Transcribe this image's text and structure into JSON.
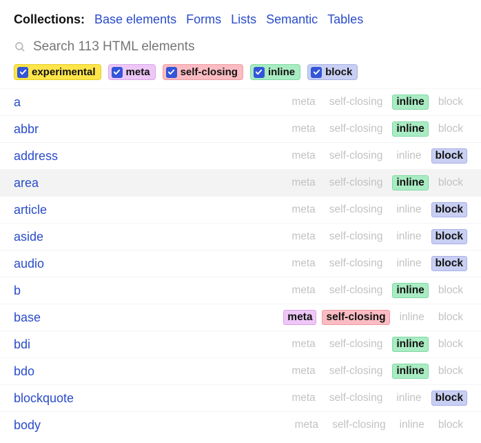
{
  "header": {
    "title": "Collections:",
    "links": [
      "Base elements",
      "Forms",
      "Lists",
      "Semantic",
      "Tables"
    ]
  },
  "search": {
    "placeholder": "Search 113 HTML elements"
  },
  "filters": [
    {
      "key": "experimental",
      "label": "experimental",
      "checked": true,
      "cls": "pill-experimental"
    },
    {
      "key": "meta",
      "label": "meta",
      "checked": true,
      "cls": "pill-meta"
    },
    {
      "key": "selfclosing",
      "label": "self-closing",
      "checked": true,
      "cls": "pill-selfclosing"
    },
    {
      "key": "inline",
      "label": "inline",
      "checked": true,
      "cls": "pill-inline"
    },
    {
      "key": "block",
      "label": "block",
      "checked": true,
      "cls": "pill-block"
    }
  ],
  "tagLabels": {
    "meta": "meta",
    "selfclosing": "self-closing",
    "inline": "inline",
    "block": "block"
  },
  "elements": [
    {
      "name": "a",
      "active": [
        "inline"
      ],
      "hover": false
    },
    {
      "name": "abbr",
      "active": [
        "inline"
      ],
      "hover": false
    },
    {
      "name": "address",
      "active": [
        "block"
      ],
      "hover": false
    },
    {
      "name": "area",
      "active": [
        "inline"
      ],
      "hover": true
    },
    {
      "name": "article",
      "active": [
        "block"
      ],
      "hover": false
    },
    {
      "name": "aside",
      "active": [
        "block"
      ],
      "hover": false
    },
    {
      "name": "audio",
      "active": [
        "block"
      ],
      "hover": false
    },
    {
      "name": "b",
      "active": [
        "inline"
      ],
      "hover": false
    },
    {
      "name": "base",
      "active": [
        "meta",
        "selfclosing"
      ],
      "hover": false
    },
    {
      "name": "bdi",
      "active": [
        "inline"
      ],
      "hover": false
    },
    {
      "name": "bdo",
      "active": [
        "inline"
      ],
      "hover": false
    },
    {
      "name": "blockquote",
      "active": [
        "block"
      ],
      "hover": false
    },
    {
      "name": "body",
      "active": [],
      "hover": false
    }
  ]
}
